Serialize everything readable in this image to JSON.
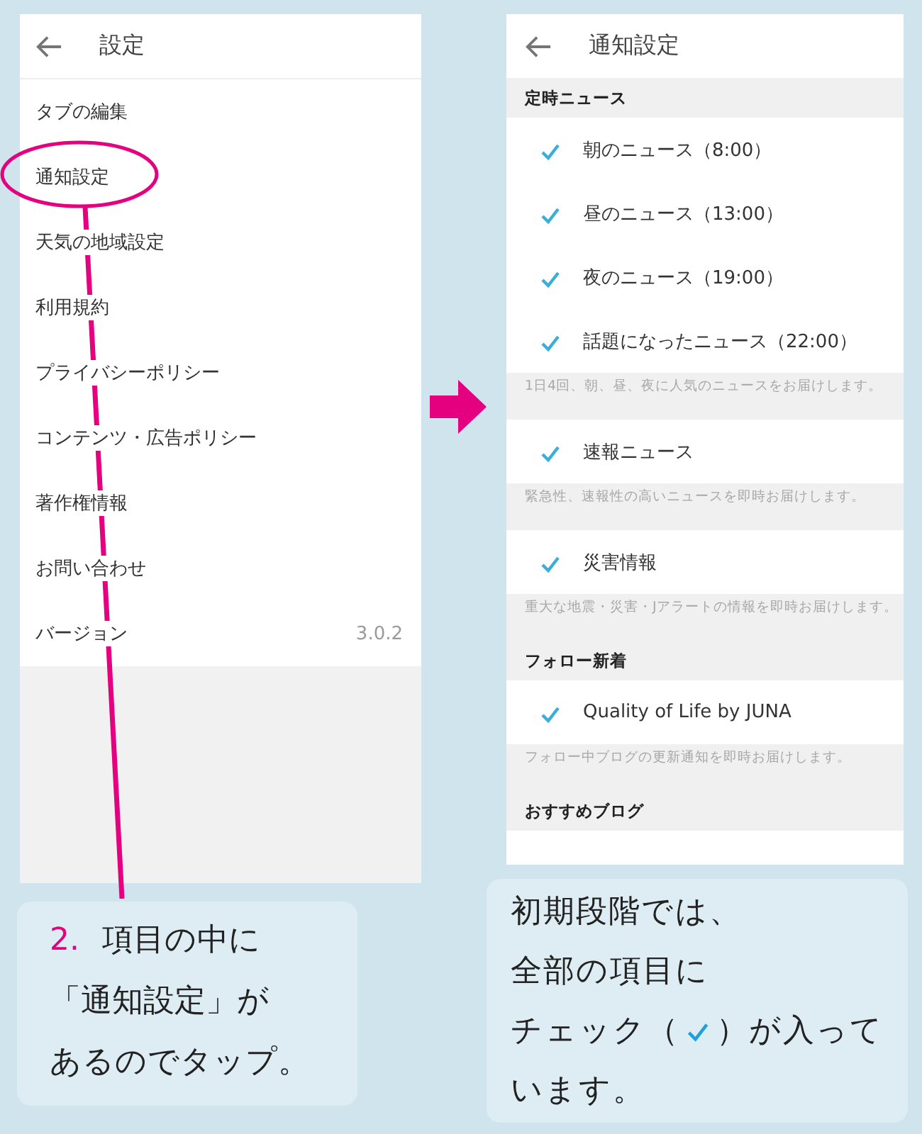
{
  "left_screen": {
    "header": {
      "title": "設定"
    },
    "items": [
      {
        "label": "タブの編集",
        "highlighted": false
      },
      {
        "label": "通知設定",
        "highlighted": true
      },
      {
        "label": "天気の地域設定",
        "highlighted": false
      },
      {
        "label": "利用規約",
        "highlighted": false
      },
      {
        "label": "プライバシーポリシー",
        "highlighted": false
      },
      {
        "label": "コンテンツ・広告ポリシー",
        "highlighted": false
      },
      {
        "label": "著作権情報",
        "highlighted": false
      },
      {
        "label": "お問い合わせ",
        "highlighted": false
      },
      {
        "label": "バージョン",
        "value": "3.0.2",
        "highlighted": false
      }
    ]
  },
  "right_screen": {
    "header": {
      "title": "通知設定"
    },
    "groups": [
      {
        "heading": "定時ニュース",
        "items": [
          {
            "label": "朝のニュース（8:00）",
            "checked": true
          },
          {
            "label": "昼のニュース（13:00）",
            "checked": true
          },
          {
            "label": "夜のニュース（19:00）",
            "checked": true
          },
          {
            "label": "話題になったニュース（22:00）",
            "checked": true
          }
        ],
        "note": "1日4回、朝、昼、夜に人気のニュースをお届けします。"
      },
      {
        "items": [
          {
            "label": "速報ニュース",
            "checked": true
          }
        ],
        "note": "緊急性、速報性の高いニュースを即時お届けします。"
      },
      {
        "items": [
          {
            "label": "災害情報",
            "checked": true
          }
        ],
        "note": "重大な地震・災害・Jアラートの情報を即時お届けします。"
      },
      {
        "heading": "フォロー新着",
        "items": [
          {
            "label": "Quality of Life by JUNA",
            "checked": true
          }
        ],
        "note": "フォロー中ブログの更新通知を即時お届けします。"
      },
      {
        "heading": "おすすめブログ"
      }
    ]
  },
  "left_caption": {
    "lines": [
      [
        {
          "kind": "number",
          "text": "2."
        },
        {
          "kind": "text",
          "text": "項目の中に"
        }
      ],
      [
        {
          "kind": "text",
          "text": "「通知設定」が"
        }
      ],
      [
        {
          "kind": "text",
          "text": "あるのでタップ。"
        }
      ]
    ]
  },
  "right_caption": {
    "lines": [
      [
        {
          "kind": "text",
          "text": "初期段階では、"
        }
      ],
      [
        {
          "kind": "text",
          "text": "全部の項目に"
        }
      ],
      [
        {
          "kind": "text",
          "text": "チェック（"
        },
        {
          "kind": "check"
        },
        {
          "kind": "text",
          "text": "）が入って"
        }
      ],
      [
        {
          "kind": "text",
          "text": "います。"
        }
      ]
    ]
  }
}
